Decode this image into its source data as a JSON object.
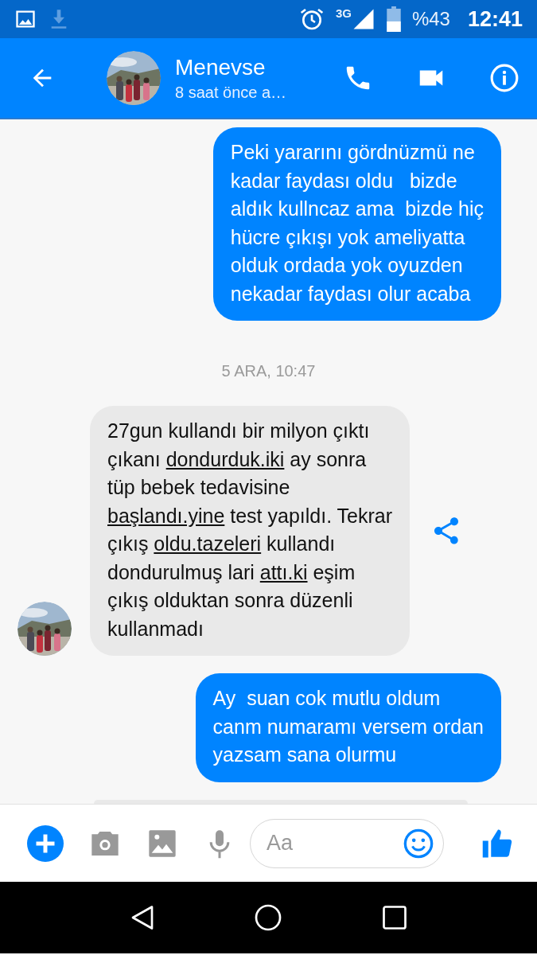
{
  "status_bar": {
    "battery_text": "%43",
    "network": "3G",
    "time": "12:41"
  },
  "header": {
    "name": "Menevse",
    "subtitle": "8 saat önce a…"
  },
  "messages": [
    {
      "kind": "outgoing",
      "parts": [
        {
          "kind": "text",
          "text": "Peki yararını gördnüzmü ne\nkadar faydası oldu   bizde\naldık kullncaz ama  bizde hiç\nhücre çıkışı yok ameliyatta\nolduk ordada yok oyuzden\nnekadar faydası olur acaba"
        }
      ]
    },
    {
      "kind": "timestamp",
      "text": "5 ARA, 10:47"
    },
    {
      "kind": "incoming",
      "parts": [
        {
          "kind": "text",
          "text": "27gun kullandı bir milyon çıktı\nçıkanı "
        },
        {
          "kind": "link",
          "text": "dondurduk.iki"
        },
        {
          "kind": "text",
          "text": " ay sonra\ntüp bebek tedavisine\n"
        },
        {
          "kind": "link",
          "text": "başlandı.yine"
        },
        {
          "kind": "text",
          "text": " test yapıldı. Tekrar\nçıkış "
        },
        {
          "kind": "link",
          "text": "oldu.tazeleri"
        },
        {
          "kind": "text",
          "text": " kullandı\ndondurulmuş lari "
        },
        {
          "kind": "link",
          "text": "attı.ki"
        },
        {
          "kind": "text",
          "text": " eşim\nçıkış olduktan sonra düzenli\nkullanmadı"
        }
      ]
    },
    {
      "kind": "outgoing",
      "parts": [
        {
          "kind": "text",
          "text": "Ay  suan cok mutlu oldum\ncanm numaramı versem ordan\nyazsam sana olurmu"
        }
      ]
    },
    {
      "kind": "incoming_partial"
    }
  ],
  "composer": {
    "placeholder": "Aa"
  }
}
